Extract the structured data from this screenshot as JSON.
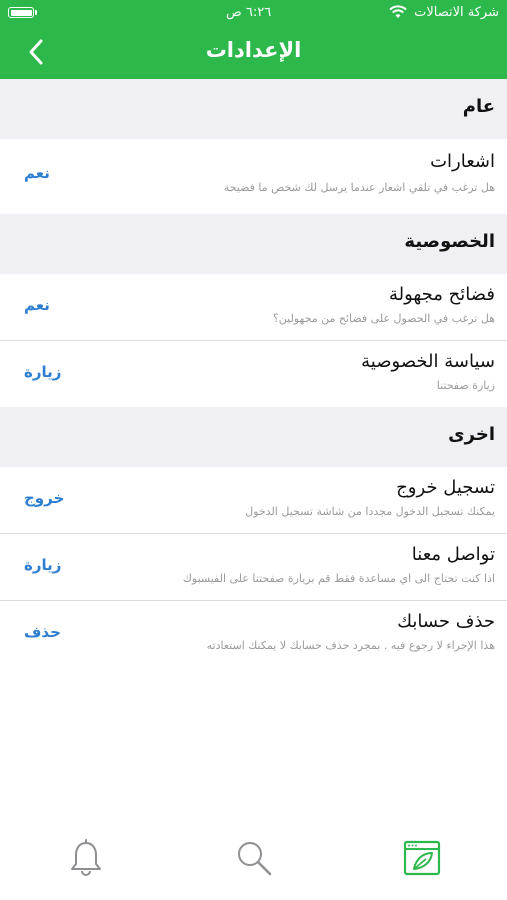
{
  "status_bar": {
    "carrier": "شركة الاتصالات",
    "time": "٦:٢٦ ص"
  },
  "nav": {
    "title": "الإعدادات",
    "back_icon": "chevron-left-icon"
  },
  "colors": {
    "brand": "#2db84b",
    "action": "#2f7fd1",
    "section_bg": "#efeff4",
    "subtitle": "#9a9a9a"
  },
  "sections": [
    {
      "header": "عام",
      "rows": [
        {
          "title": "اشعارات",
          "subtitle": "هل ترغب في تلقي اشعار عندما يرسل لك شخص ما فضيحة",
          "action": "نعم"
        }
      ]
    },
    {
      "header": "الخصوصية",
      "rows": [
        {
          "title": "فضائح مجهولة",
          "subtitle": "هل ترغب في الحصول على فضائح من مجهولين؟",
          "action": "نعم"
        },
        {
          "title": "سياسة الخصوصية",
          "subtitle": "زيارة صفحتنا",
          "action": "زيارة"
        }
      ]
    },
    {
      "header": "اخرى",
      "rows": [
        {
          "title": "تسجيل خروج",
          "subtitle": "يمكنك تسجيل الدخول مجددا من شاشة تسجيل الدخول",
          "action": "خروج"
        },
        {
          "title": "تواصل معنا",
          "subtitle": "اذا كنت تحتاج الى اي مساعدة فقط قم بزيارة صفحتنا على الفيسبوك",
          "action": "زيارة"
        },
        {
          "title": "حذف حسابك",
          "subtitle": "هذا الإجراء لا رجوع فيه . بمجرد حذف حسابك لا يمكنك استعادته",
          "action": "حذف"
        }
      ]
    }
  ],
  "tab_bar": {
    "tabs": [
      {
        "icon": "bell-icon",
        "active": false
      },
      {
        "icon": "search-icon",
        "active": false
      },
      {
        "icon": "feed-browser-icon",
        "active": true
      }
    ]
  }
}
